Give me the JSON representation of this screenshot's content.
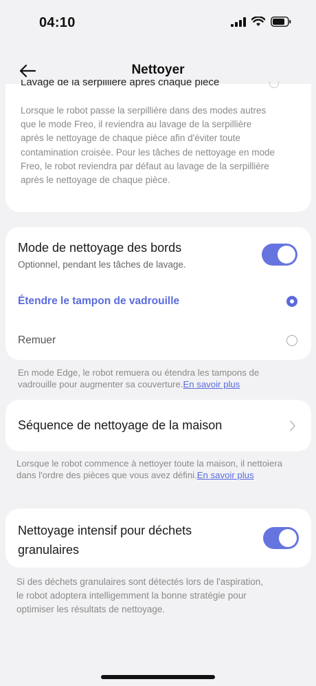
{
  "status": {
    "time": "04:10"
  },
  "header": {
    "title": "Nettoyer"
  },
  "top_card": {
    "partial_label": "Lavage de la serpillière après chaque pièce",
    "description": "Lorsque le robot passe la serpillière dans des modes autres que le mode Freo, il reviendra au lavage de la serpillière après le nettoyage de chaque pièce afin d'éviter toute contamination croisée. Pour les tâches de nettoyage en mode Freo, le robot reviendra par défaut au lavage de la serpillière après le nettoyage de chaque pièce."
  },
  "edge_card": {
    "title": "Mode de nettoyage des bords",
    "subtitle": "Optionnel, pendant les tâches de lavage.",
    "toggle_on": true,
    "options": [
      {
        "label": "Étendre le tampon de vadrouille",
        "selected": true
      },
      {
        "label": "Remuer",
        "selected": false
      }
    ],
    "note": "En mode Edge, le robot remuera ou étendra les tampons de vadrouille pour augmenter sa couverture.",
    "note_link": "En savoir plus"
  },
  "sequence_card": {
    "title": "Séquence de nettoyage de la maison",
    "note": "Lorsque le robot commence à nettoyer toute la maison, il nettoiera dans l'ordre des pièces que vous avez défini.",
    "note_link": "En savoir plus"
  },
  "intense_card": {
    "title": "Nettoyage intensif pour déchets granulaires",
    "toggle_on": true,
    "note": "Si des déchets granulaires sont détectés lors de l'aspiration, le robot adoptera intelligemment la bonne stratégie pour optimiser les résultats de nettoyage."
  },
  "colors": {
    "accent": "#5a6bdc",
    "toggle": "#6674e0",
    "background": "#f2f2f4"
  },
  "icons": [
    "signal-icon",
    "wifi-icon",
    "battery-icon",
    "back-arrow-icon",
    "chevron-right-icon"
  ]
}
